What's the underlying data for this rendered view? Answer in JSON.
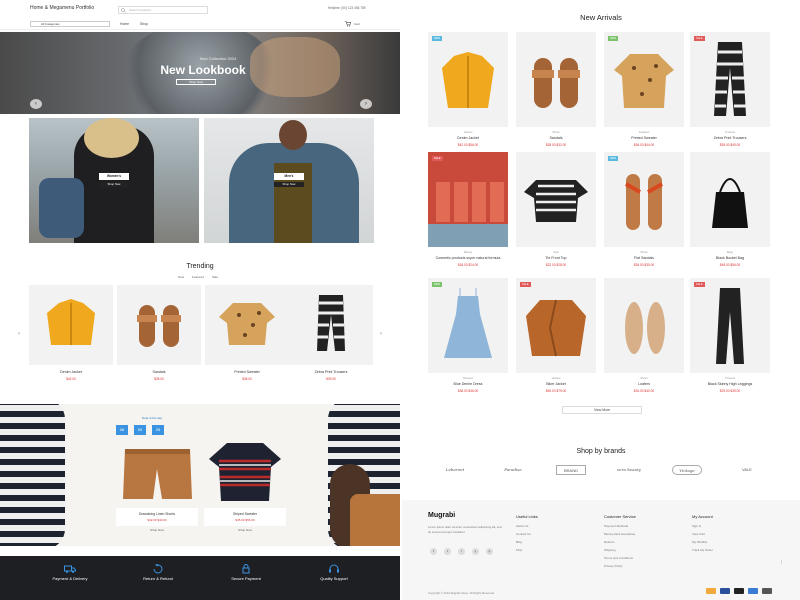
{
  "header": {
    "brand": "Home & Megamenu Portfolio",
    "search_placeholder": "Search products...",
    "helpline": "Helpline: (00) 123 456 789",
    "category_select": "All Categories",
    "nav": [
      "Home",
      "Shop"
    ],
    "cart": "Cart"
  },
  "hero": {
    "kicker": "New Collection 2024",
    "title": "New Lookbook",
    "button": "Shop Now",
    "prev": "‹",
    "next": "›"
  },
  "banners": [
    {
      "label": "Women's",
      "button": "Shop Now"
    },
    {
      "label": "Men's",
      "button": "Shop Now"
    }
  ],
  "trending": {
    "title": "Trending",
    "tabs": [
      "New",
      "Featured",
      "Sale"
    ],
    "items": [
      {
        "name": "Denim Jacket",
        "price": "$42.00",
        "image": "yellow-jacket"
      },
      {
        "name": "Sandals",
        "price": "$28.00",
        "image": "sandals"
      },
      {
        "name": "Printed Sweater",
        "price": "$36.00",
        "image": "leopard-sweater"
      },
      {
        "name": "Zebra Print Trousers",
        "price": "$39.00",
        "image": "zebra-pants"
      }
    ],
    "prev": "‹",
    "next": "›"
  },
  "promo": {
    "deal_label": "Deal of the day",
    "timer": [
      "08",
      "09",
      "25"
    ],
    "items": [
      {
        "name": "Drawstring Linen Shorts",
        "price": "$32.00  $40.00",
        "more": "Shop Now"
      },
      {
        "name": "Striped Sweater",
        "price": "$45.00  $56.00",
        "more": "Shop Now"
      }
    ]
  },
  "features": [
    "Payment & Delivery",
    "Return & Refund",
    "Secure Payment",
    "Quality Support"
  ],
  "new_arrivals": {
    "title": "New Arrivals",
    "products": [
      {
        "badge": "NEW",
        "badge_color": "#5bb9e0",
        "cat": "Jackets",
        "name": "Denim Jacket",
        "price": "$42.00  $56.00",
        "image": "yellow-jacket"
      },
      {
        "badge": "",
        "badge_color": "",
        "cat": "Shoes",
        "name": "Sandals",
        "price": "$28.00  $32.00",
        "image": "sandals"
      },
      {
        "badge": "NEW",
        "badge_color": "#7ac36a",
        "cat": "Sweaters",
        "name": "Printed Sweater",
        "price": "$36.00  $44.00",
        "image": "leopard-sweater"
      },
      {
        "badge": "SALE",
        "badge_color": "#e05a5a",
        "cat": "Trousers",
        "name": "Zebra Print Trousers",
        "price": "$39.00  $49.00",
        "image": "zebra-pants"
      },
      {
        "badge": "SALE",
        "badge_color": "#e05a5a",
        "cat": "Beauty",
        "name": "Cosmetic products super natural formula",
        "price": "$18.00  $24.00",
        "image": "bottles"
      },
      {
        "badge": "",
        "badge_color": "",
        "cat": "Tops",
        "name": "Tie Front Top",
        "price": "$22.00  $28.00",
        "image": "zebra-top"
      },
      {
        "badge": "NEW",
        "badge_color": "#5bb9e0",
        "cat": "Shoes",
        "name": "Flat Sandals",
        "price": "$26.00  $30.00",
        "image": "red-sandals"
      },
      {
        "badge": "",
        "badge_color": "",
        "cat": "Bags",
        "name": "Black Bucket Bag",
        "price": "$48.00  $56.00",
        "image": "bucket-bag"
      },
      {
        "badge": "NEW",
        "badge_color": "#7ac36a",
        "cat": "Dresses",
        "name": "Blue Denim Dress",
        "price": "$38.00  $46.00",
        "image": "blue-dress"
      },
      {
        "badge": "SALE",
        "badge_color": "#e05a5a",
        "cat": "Jackets",
        "name": "Biker Jacket",
        "price": "$69.00  $79.00",
        "image": "brown-jacket"
      },
      {
        "badge": "",
        "badge_color": "",
        "cat": "Shoes",
        "name": "Loafers",
        "price": "$34.00  $40.00",
        "image": "loafers"
      },
      {
        "badge": "SALE",
        "badge_color": "#e05a5a",
        "cat": "Trousers",
        "name": "Black Skinny High Leggings",
        "price": "$29.00  $35.00",
        "image": "black-pants"
      }
    ],
    "view_more": "View More"
  },
  "brands": {
    "title": "Shop by brands",
    "logos": [
      "Lebarnet",
      "Paradise",
      "BRAND",
      "vera beauty",
      "Vintage",
      "VALE"
    ]
  },
  "footer": {
    "logo": "Mugrabi",
    "desc": "Lorem ipsum dolor sit amet, consectetur adipiscing elit, sed do eiusmod tempor incididunt.",
    "social": [
      "f",
      "t",
      "i",
      "y",
      "p"
    ],
    "columns": [
      {
        "heading": "Useful Links",
        "links": [
          "About Us",
          "Contact Us",
          "Blog",
          "FAQ"
        ]
      },
      {
        "heading": "Customer Service",
        "links": [
          "Payment Methods",
          "Money-back Guarantee",
          "Returns",
          "Shipping",
          "Terms and Conditions",
          "Privacy Policy"
        ]
      },
      {
        "heading": "My Account",
        "links": [
          "Sign In",
          "View Cart",
          "My Wishlist",
          "Track My Order"
        ]
      }
    ],
    "copyright": "Copyright © 2024 Mugrabi Store. All Rights Reserved.",
    "up": "↑"
  },
  "colors": {
    "accent": "#3a93e0",
    "sale": "#d33333",
    "dark": "#1e1f23"
  }
}
